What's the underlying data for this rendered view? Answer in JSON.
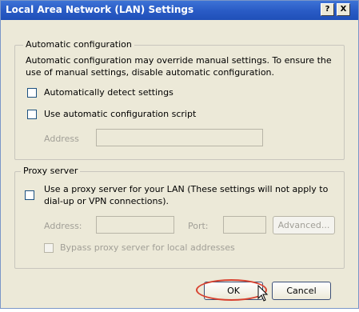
{
  "dialog": {
    "title": "Local Area Network (LAN) Settings",
    "help_label": "?",
    "close_label": "X"
  },
  "auto_config": {
    "legend": "Automatic configuration",
    "description_line1": "Automatic configuration may override manual settings.  To ensure the",
    "description_line2": "use of manual settings, disable automatic configuration.",
    "detect_label": "Automatically detect settings",
    "detect_checked": false,
    "script_label": "Use automatic configuration script",
    "script_checked": false,
    "address_label": "Address",
    "address_value": ""
  },
  "proxy": {
    "legend": "Proxy server",
    "use_proxy_line1": "Use a proxy server for your LAN (These settings will not apply to",
    "use_proxy_line2": "dial-up or VPN connections).",
    "use_proxy_checked": false,
    "address_label": "Address:",
    "address_value": "",
    "port_label": "Port:",
    "port_value": "",
    "advanced_label": "Advanced...",
    "bypass_label": "Bypass proxy server for local addresses",
    "bypass_checked": false
  },
  "footer": {
    "ok_label": "OK",
    "cancel_label": "Cancel"
  },
  "colors": {
    "titlebar": "#2a5cc6",
    "dialog_bg": "#ece9d8",
    "highlight_oval": "#d8412f"
  }
}
